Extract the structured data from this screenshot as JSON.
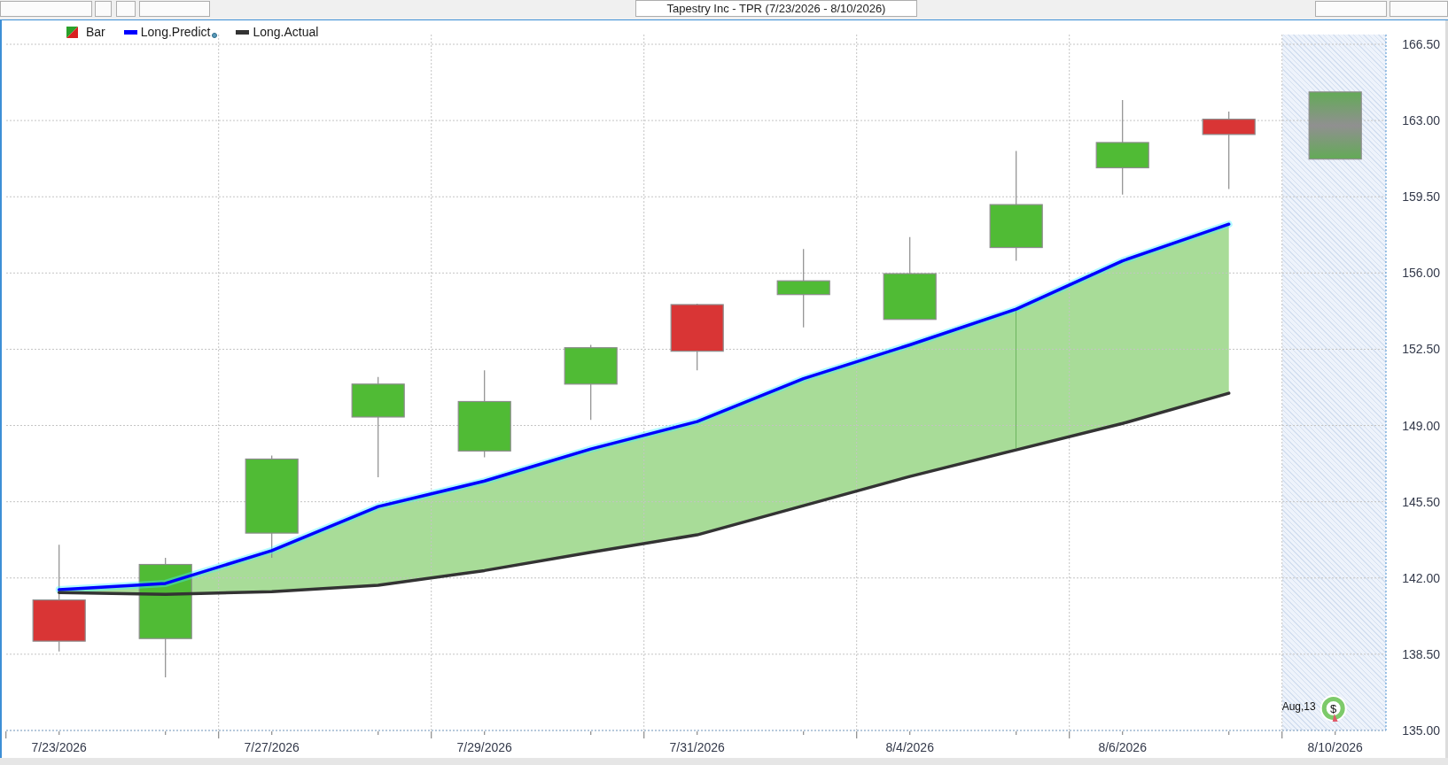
{
  "toolbar": {
    "title": "Tapestry Inc - TPR (7/23/2026 - 8/10/2026)"
  },
  "chart": {
    "event": {
      "label": "Aug,13",
      "symbol": "$"
    },
    "chart_data": {
      "type": "candlestick",
      "grid": true,
      "categories": [
        "7/23/2026",
        null,
        "7/27/2026",
        null,
        "7/29/2026",
        null,
        "7/31/2026",
        null,
        "8/4/2026",
        null,
        "8/6/2026",
        null,
        "8/10/2026"
      ],
      "ylim": [
        135,
        166.5
      ],
      "yticks": [
        {
          "value": 135,
          "label": "135.00"
        },
        {
          "value": 138.5,
          "label": "138.50"
        },
        {
          "value": 142,
          "label": "142.00"
        },
        {
          "value": 145.5,
          "label": "145.50"
        },
        {
          "value": 149,
          "label": "149.00"
        },
        {
          "value": 152.5,
          "label": "152.50"
        },
        {
          "value": 156,
          "label": "156.00"
        },
        {
          "value": 159.5,
          "label": "159.50"
        },
        {
          "value": 163,
          "label": "163.00"
        },
        {
          "value": 166.5,
          "label": "166.50"
        }
      ],
      "series": [
        {
          "name": "Bar",
          "type": "candlestick",
          "ohlc": [
            [
              140.99,
              143.53,
              138.63,
              139.1
            ],
            [
              139.22,
              142.93,
              137.44,
              142.62
            ],
            [
              144.06,
              147.62,
              142.93,
              147.46
            ],
            [
              149.39,
              151.23,
              146.62,
              150.9
            ],
            [
              147.83,
              151.53,
              147.54,
              150.1
            ],
            [
              150.9,
              152.7,
              149.26,
              152.57
            ],
            [
              154.55,
              154.59,
              151.53,
              152.41
            ],
            [
              155.01,
              157.1,
              153.5,
              155.64
            ],
            [
              153.87,
              157.65,
              153.87,
              155.97
            ],
            [
              157.17,
              161.6,
              156.56,
              159.14
            ],
            [
              160.83,
              163.94,
              159.6,
              161.99
            ],
            [
              163.06,
              163.41,
              159.85,
              162.36
            ],
            null
          ]
        },
        {
          "name": "Long.Predict",
          "type": "line",
          "color": "#0000ff",
          "values": [
            141.46,
            141.75,
            143.26,
            145.28,
            146.45,
            147.92,
            149.18,
            151.15,
            152.7,
            154.34,
            156.56,
            158.24,
            null
          ]
        },
        {
          "name": "Long.Actual",
          "type": "line",
          "color": "#333333",
          "values": [
            141.33,
            141.25,
            141.37,
            141.67,
            142.34,
            143.18,
            143.98,
            145.32,
            146.66,
            147.88,
            149.09,
            150.48,
            null
          ]
        },
        {
          "type": "candlestick",
          "ohlc": [
            null,
            null,
            null,
            null,
            null,
            null,
            null,
            null,
            null,
            null,
            null,
            null,
            [
              161.23,
              164.31,
              161.23,
              164.31
            ]
          ]
        }
      ]
    }
  }
}
